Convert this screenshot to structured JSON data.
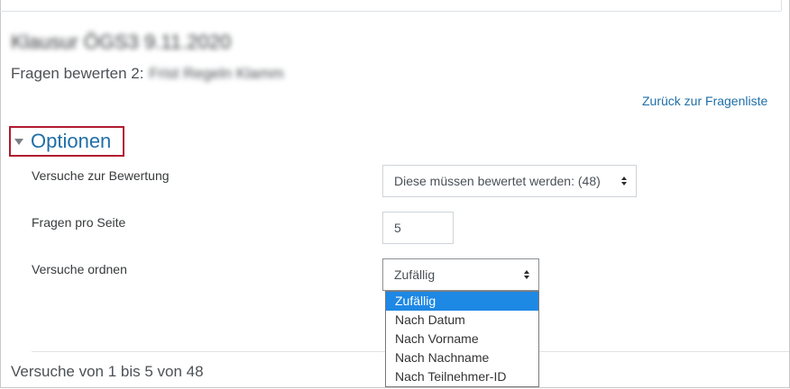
{
  "page": {
    "quiz_title": "Klausur ÖGS3 9.11.2020",
    "grading_prefix": "Fragen bewerten 2:",
    "grading_question": "Frist Regeln Klamm"
  },
  "back_link": "Zurück zur Fragenliste",
  "options": {
    "heading": "Optionen",
    "attempts_label": "Versuche zur Bewertung",
    "attempts_value": "Diese müssen bewertet werden: (48)",
    "per_page_label": "Fragen pro Seite",
    "per_page_value": "5",
    "order_label": "Versuche ordnen",
    "order_value": "Zufällig",
    "order_options": [
      "Zufällig",
      "Nach Datum",
      "Nach Vorname",
      "Nach Nachname",
      "Nach Teilnehmer-ID"
    ]
  },
  "summary": "Versuche von 1 bis 5 von 48",
  "colors": {
    "link": "#1f6fa8",
    "highlight_box": "#b11b2f",
    "selected_option": "#1e88e5"
  }
}
